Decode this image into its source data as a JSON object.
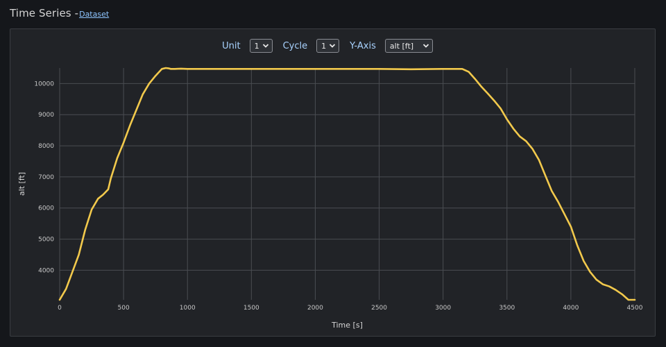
{
  "header": {
    "title": "Time Series -",
    "dataset_link": "Dataset"
  },
  "controls": {
    "unit_label": "Unit",
    "unit_value": "1",
    "cycle_label": "Cycle",
    "cycle_value": "1",
    "yaxis_label": "Y-Axis",
    "yaxis_value": "alt [ft]"
  },
  "colors": {
    "series": "#f2c94c",
    "grid": "#4a4d52",
    "panel": "#212327"
  },
  "chart_data": {
    "type": "line",
    "xlabel": "Time [s]",
    "ylabel": "alt [ft]",
    "xlim": [
      0,
      4500
    ],
    "ylim": [
      3050,
      10500
    ],
    "xticks": [
      0,
      500,
      1000,
      1500,
      2000,
      2500,
      3000,
      3500,
      4000,
      4500
    ],
    "yticks": [
      4000,
      5000,
      6000,
      7000,
      8000,
      9000,
      10000
    ],
    "grid": true,
    "series": [
      {
        "x": [
          0,
          50,
          100,
          150,
          200,
          250,
          300,
          340,
          380,
          400,
          450,
          500,
          550,
          600,
          650,
          700,
          750,
          800,
          830,
          850,
          870,
          900,
          950,
          1000,
          1500,
          2000,
          2500,
          2750,
          3000,
          3150,
          3200,
          3250,
          3300,
          3350,
          3400,
          3450,
          3500,
          3550,
          3600,
          3650,
          3700,
          3750,
          3800,
          3850,
          3900,
          3950,
          4000,
          4050,
          4100,
          4150,
          4200,
          4250,
          4300,
          4350,
          4400,
          4450,
          4500
        ],
        "y": [
          3050,
          3400,
          3950,
          4500,
          5300,
          5950,
          6300,
          6430,
          6600,
          6950,
          7600,
          8100,
          8650,
          9150,
          9650,
          10000,
          10250,
          10470,
          10500,
          10490,
          10470,
          10470,
          10480,
          10470,
          10470,
          10470,
          10470,
          10460,
          10470,
          10470,
          10380,
          10150,
          9900,
          9680,
          9450,
          9200,
          8850,
          8550,
          8300,
          8150,
          7900,
          7550,
          7050,
          6550,
          6200,
          5800,
          5400,
          4800,
          4300,
          3950,
          3700,
          3550,
          3480,
          3370,
          3230,
          3050,
          3050
        ]
      }
    ]
  }
}
